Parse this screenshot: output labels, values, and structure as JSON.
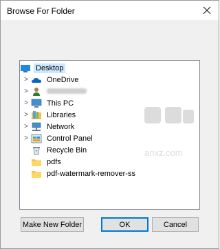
{
  "window": {
    "title": "Browse For Folder",
    "close_icon": "close-icon"
  },
  "tree": {
    "items": [
      {
        "label": "Desktop",
        "icon": "desktop-icon",
        "expandable": false,
        "selected": true
      },
      {
        "label": "OneDrive",
        "icon": "cloud-icon",
        "expandable": true,
        "selected": false
      },
      {
        "label": "",
        "icon": "user-icon",
        "expandable": true,
        "selected": false,
        "redacted": true
      },
      {
        "label": "This PC",
        "icon": "computer-icon",
        "expandable": true,
        "selected": false
      },
      {
        "label": "Libraries",
        "icon": "libraries-icon",
        "expandable": true,
        "selected": false
      },
      {
        "label": "Network",
        "icon": "network-icon",
        "expandable": true,
        "selected": false
      },
      {
        "label": "Control Panel",
        "icon": "control-panel-icon",
        "expandable": true,
        "selected": false
      },
      {
        "label": "Recycle Bin",
        "icon": "recycle-bin-icon",
        "expandable": false,
        "selected": false
      },
      {
        "label": "pdfs",
        "icon": "folder-icon",
        "expandable": false,
        "selected": false
      },
      {
        "label": "pdf-watermark-remover-ss",
        "icon": "folder-icon",
        "expandable": false,
        "selected": false
      }
    ]
  },
  "buttons": {
    "make_new_folder": "Make New Folder",
    "ok": "OK",
    "cancel": "Cancel"
  },
  "watermark": {
    "text": "anxz.com"
  },
  "colors": {
    "selection": "#cce8ff",
    "accent": "#0078d7",
    "folder": "#f5c34a"
  }
}
